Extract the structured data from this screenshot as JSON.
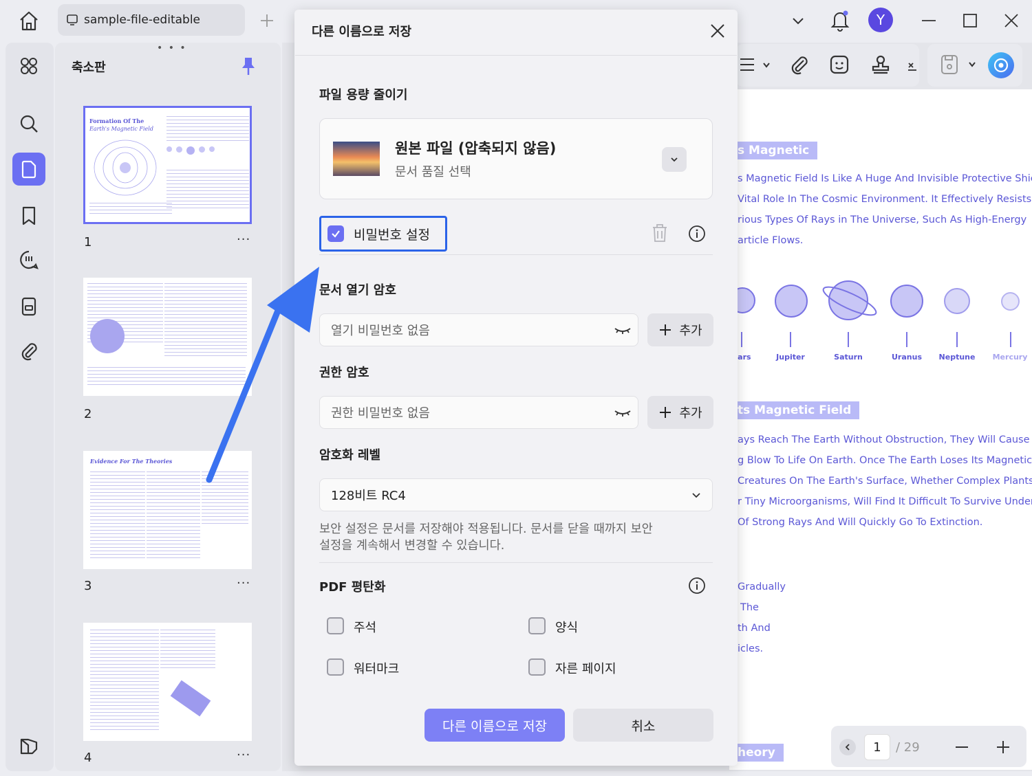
{
  "titlebar": {
    "file_tab": "sample-file-editable",
    "avatar_letter": "Y"
  },
  "thumbnails": {
    "title": "축소판",
    "pages": [
      {
        "num": "1",
        "heading": "Formation Of The",
        "heading2": "Earth's Magnetic Field"
      },
      {
        "num": "2"
      },
      {
        "num": "3",
        "heading": "Evidence For The Theories"
      },
      {
        "num": "4"
      }
    ]
  },
  "document": {
    "heading1": "s Magnetic",
    "para1": [
      "s Magnetic Field Is Like A Huge And Invisible Protective Shield,",
      "Vital Role In The Cosmic Environment. It Effectively Resists Most",
      "rious Types Of Rays in The Universe, Such As High-Energy",
      "article Flows."
    ],
    "planets": [
      "lars",
      "Jupiter",
      "Saturn",
      "Uranus",
      "Neptune",
      "Mercury"
    ],
    "heading2": "ts Magnetic Field",
    "para2": [
      "ays Reach The Earth Without Obstruction, They Will Cause A",
      "g Blow To Life On Earth. Once The Earth Loses Its Magnetic",
      "Creatures On The Earth's Surface, Whether Complex Plants And",
      "r Tiny Microorganisms, Will Find It Difficult To Survive Under The",
      "Of Strong Rays And Will Quickly Go To Extinction."
    ],
    "para3": [
      "Gradually",
      "The",
      "th And",
      "icles."
    ],
    "heading3": "heory"
  },
  "pager": {
    "current": "1",
    "total": "/ 29"
  },
  "dialog": {
    "title": "다른 이름으로 저장",
    "reduce_section": "파일 용량 줄이기",
    "quality_title": "원본 파일 (압축되지 않음)",
    "quality_sub": "문서 품질 선택",
    "password_checkbox": "비밀번호 설정",
    "password_checked": true,
    "open_pw_section": "문서 열기 암호",
    "open_pw_placeholder": "열기 비밀번호 없음",
    "add_label": "추가",
    "perm_pw_section": "권한 암호",
    "perm_pw_placeholder": "권한 비밀번호 없음",
    "enc_section": "암호화 레벨",
    "enc_value": "128비트 RC4",
    "notice_line1": "보안 설정은 문서를 저장해야 적용됩니다. 문서를 닫을 때까지 보안",
    "notice_line2": "설정을 계속해서 변경할 수 있습니다.",
    "flatten_section": "PDF 평탄화",
    "flatten_options": [
      "주석",
      "양식",
      "워터마크",
      "자른 페이지"
    ],
    "save_button": "다른 이름으로 저장",
    "cancel_button": "취소"
  },
  "colors": {
    "accent": "#6b6ff2",
    "highlight": "#2b63e8",
    "arrow": "#3a72f0"
  }
}
